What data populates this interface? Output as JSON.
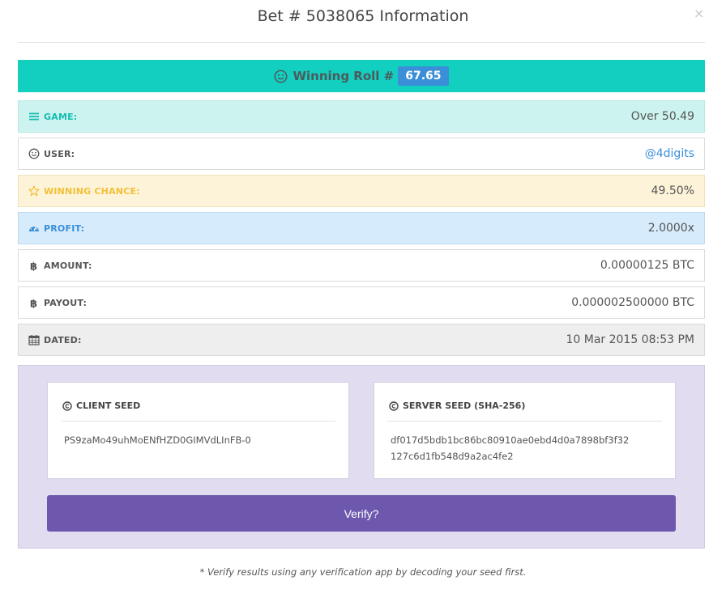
{
  "modal": {
    "title": "Bet # 5038065 Information",
    "close_glyph": "×"
  },
  "winning_roll": {
    "label": "Winning Roll #",
    "value": "67.65",
    "icon": "smile-icon",
    "bar_color": "#13cfc0",
    "badge_color": "#3a8fd8"
  },
  "details": {
    "game": {
      "label": "GAME:",
      "value": "Over 50.49",
      "icon": "list-icon"
    },
    "user": {
      "label": "USER:",
      "value": "@4digits",
      "icon": "smile-icon"
    },
    "chance": {
      "label": "WINNING CHANCE:",
      "value": "49.50%",
      "icon": "star-icon"
    },
    "profit": {
      "label": "PROFIT:",
      "value": "2.0000x",
      "icon": "dashboard-icon"
    },
    "amount": {
      "label": "AMOUNT:",
      "value": "0.00000125 BTC",
      "icon": "bitcoin-icon"
    },
    "payout": {
      "label": "PAYOUT:",
      "value": "0.000002500000 BTC",
      "icon": "bitcoin-icon"
    },
    "dated": {
      "label": "DATED:",
      "value": "10 Mar 2015 08:53 PM",
      "icon": "calendar-icon"
    }
  },
  "seeds": {
    "client": {
      "title": "CLIENT SEED",
      "value": "PS9zaMo49uhMoENfHZD0GIMVdLInFB-0",
      "icon": "copyright-icon"
    },
    "server": {
      "title": "SERVER SEED (SHA-256)",
      "value": "df017d5bdb1bc86bc80910ae0ebd4d0a7898bf3f32127c6d1fb548d9a2ac4fe2",
      "icon": "copyright-icon"
    }
  },
  "verify_button": {
    "label": "Verify?",
    "color": "#6d58ae"
  },
  "footnote": "* Verify results using any verification app by decoding your seed first."
}
